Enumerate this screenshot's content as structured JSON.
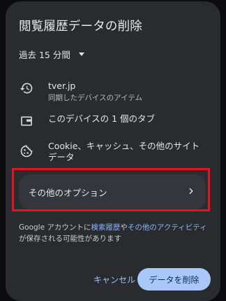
{
  "dialog": {
    "title": "閲覧履歴データの削除",
    "time_range": "過去 15 分間"
  },
  "items": [
    {
      "icon": "history-icon",
      "title": "tver.jp",
      "subtitle": "同期したデバイスのアイテム"
    },
    {
      "icon": "tab-icon",
      "title": "このデバイスの 1 個のタブ"
    },
    {
      "icon": "cookie-icon",
      "title": "Cookie、キャッシュ、その他のサイトデータ"
    }
  ],
  "more_options": {
    "label": "その他のオプション",
    "icon": "chevron-right-icon"
  },
  "footer": {
    "text_before": "Google アカウントに",
    "link_search_history": "検索履歴",
    "text_middle": "や",
    "link_other_activity": "その他のアクティビティ",
    "text_after": "が保存される可能性があります"
  },
  "buttons": {
    "cancel": "キャンセル",
    "delete": "データを削除"
  },
  "colors": {
    "dialog_bg": "#2a2b2f",
    "link": "#8ab4f8",
    "primary_button": "#a9c7f8",
    "highlight_border": "#e4141b"
  }
}
